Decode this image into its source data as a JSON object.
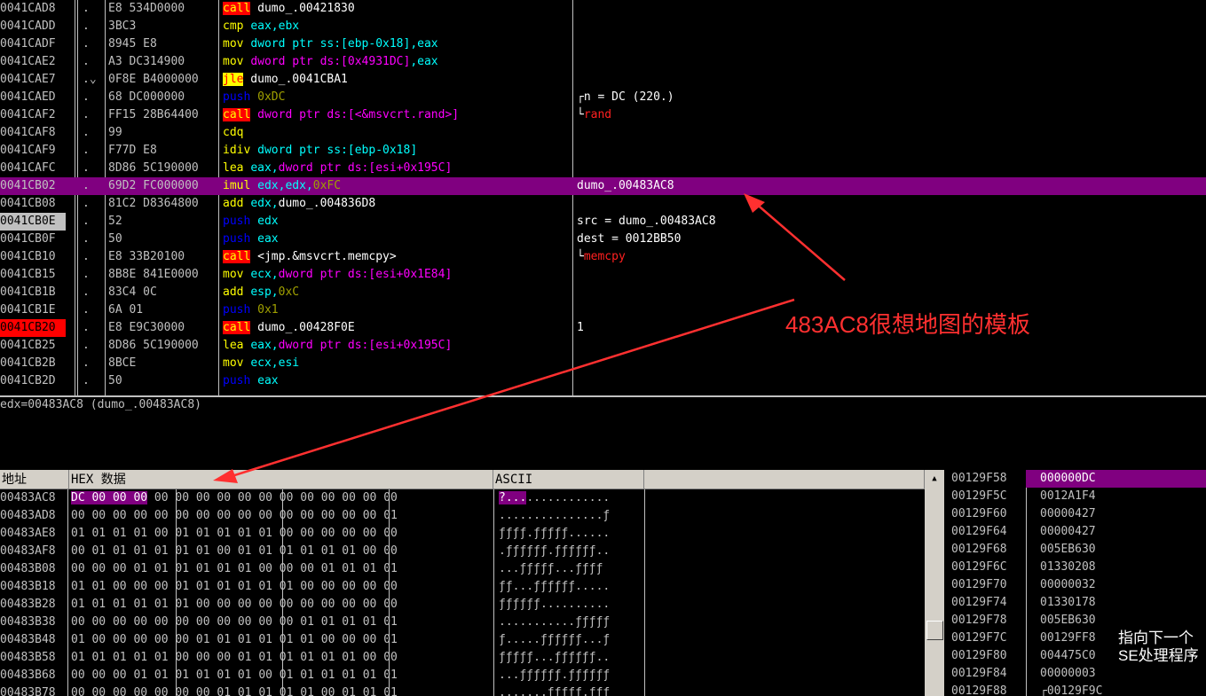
{
  "disasm": [
    {
      "addr": "0041CAD8",
      "mark": ".",
      "hex": "E8 534D0000",
      "asm": [
        [
          "callbg",
          "call"
        ],
        [
          "white",
          " dumo_.00421830"
        ]
      ],
      "cmt": []
    },
    {
      "addr": "0041CADD",
      "mark": ".",
      "hex": "3BC3",
      "asm": [
        [
          "yellow",
          "cmp "
        ],
        [
          "cyan",
          "eax,ebx"
        ]
      ],
      "cmt": []
    },
    {
      "addr": "0041CADF",
      "mark": ".",
      "hex": "8945 E8",
      "asm": [
        [
          "yellow",
          "mov "
        ],
        [
          "cyan",
          "dword ptr ss:[ebp-0x18],eax"
        ]
      ],
      "cmt": []
    },
    {
      "addr": "0041CAE2",
      "mark": ".",
      "hex": "A3 DC314900",
      "asm": [
        [
          "yellow",
          "mov "
        ],
        [
          "mag",
          "dword ptr ds:[0x4931DC]"
        ],
        [
          "cyan",
          ",eax"
        ]
      ],
      "cmt": []
    },
    {
      "addr": "0041CAE7",
      "mark": ".⌄",
      "hex": "0F8E B4000000",
      "asm": [
        [
          "jmpbg",
          "jle"
        ],
        [
          "white",
          " dumo_.0041CBA1"
        ]
      ],
      "cmt": []
    },
    {
      "addr": "0041CAED",
      "mark": ".",
      "hex": "68 DC000000",
      "asm": [
        [
          "blue",
          "push "
        ],
        [
          "oliv",
          "0xDC"
        ]
      ],
      "cmt": [
        [
          "white",
          "┌n = DC (220.)"
        ]
      ]
    },
    {
      "addr": "0041CAF2",
      "mark": ".",
      "hex": "FF15 28B64400",
      "asm": [
        [
          "callbg",
          "call"
        ],
        [
          "mag",
          " dword ptr ds:[<&msvcrt.rand>]"
        ]
      ],
      "cmt": [
        [
          "white",
          "└"
        ],
        [
          "red",
          "rand"
        ]
      ]
    },
    {
      "addr": "0041CAF8",
      "mark": ".",
      "hex": "99",
      "asm": [
        [
          "yellow",
          "cdq"
        ]
      ],
      "cmt": []
    },
    {
      "addr": "0041CAF9",
      "mark": ".",
      "hex": "F77D E8",
      "asm": [
        [
          "yellow",
          "idiv "
        ],
        [
          "cyan",
          "dword ptr ss:[ebp-0x18]"
        ]
      ],
      "cmt": []
    },
    {
      "addr": "0041CAFC",
      "mark": ".",
      "hex": "8D86 5C190000",
      "asm": [
        [
          "yellow",
          "lea "
        ],
        [
          "cyan",
          "eax,"
        ],
        [
          "mag",
          "dword ptr ds:[esi+0x195C]"
        ]
      ],
      "cmt": []
    },
    {
      "addr": "0041CB02",
      "mark": ".",
      "hex": "69D2 FC000000",
      "asm": [
        [
          "yellow",
          "imul "
        ],
        [
          "cyan",
          "edx,edx,"
        ],
        [
          "oliv",
          "0xFC"
        ]
      ],
      "cmt": [
        [
          "white",
          "dumo_.00483AC8"
        ]
      ],
      "selected": true
    },
    {
      "addr": "0041CB08",
      "mark": ".",
      "hex": "81C2 D8364800",
      "asm": [
        [
          "yellow",
          "add "
        ],
        [
          "cyan",
          "edx,"
        ],
        [
          "white",
          "dumo_.004836D8"
        ]
      ],
      "cmt": []
    },
    {
      "addr": "0041CB0E",
      "mark": ".",
      "hex": "52",
      "asm": [
        [
          "blue",
          "push "
        ],
        [
          "cyan",
          "edx"
        ]
      ],
      "cmt": [
        [
          "white",
          "src = dumo_.00483AC8"
        ]
      ],
      "addrhl": "hl1"
    },
    {
      "addr": "0041CB0F",
      "mark": ".",
      "hex": "50",
      "asm": [
        [
          "blue",
          "push "
        ],
        [
          "cyan",
          "eax"
        ]
      ],
      "cmt": [
        [
          "white",
          "dest = 0012BB50"
        ]
      ]
    },
    {
      "addr": "0041CB10",
      "mark": ".",
      "hex": "E8 33B20100",
      "asm": [
        [
          "callbg",
          "call"
        ],
        [
          "white",
          " <jmp.&msvcrt.memcpy>"
        ]
      ],
      "cmt": [
        [
          "white",
          "└"
        ],
        [
          "red",
          "memcpy"
        ]
      ]
    },
    {
      "addr": "0041CB15",
      "mark": ".",
      "hex": "8B8E 841E0000",
      "asm": [
        [
          "yellow",
          "mov "
        ],
        [
          "cyan",
          "ecx,"
        ],
        [
          "mag",
          "dword ptr ds:[esi+0x1E84]"
        ]
      ],
      "cmt": []
    },
    {
      "addr": "0041CB1B",
      "mark": ".",
      "hex": "83C4 0C",
      "asm": [
        [
          "yellow",
          "add "
        ],
        [
          "cyan",
          "esp,"
        ],
        [
          "oliv",
          "0xC"
        ]
      ],
      "cmt": []
    },
    {
      "addr": "0041CB1E",
      "mark": ".",
      "hex": "6A 01",
      "asm": [
        [
          "blue",
          "push "
        ],
        [
          "oliv",
          "0x1"
        ]
      ],
      "cmt": []
    },
    {
      "addr": "0041CB20",
      "mark": ".",
      "hex": "E8 E9C30000",
      "asm": [
        [
          "callbg",
          "call"
        ],
        [
          "white",
          " dumo_.00428F0E"
        ]
      ],
      "cmt": [
        [
          "white",
          "1"
        ]
      ],
      "addrhl": "hl2"
    },
    {
      "addr": "0041CB25",
      "mark": ".",
      "hex": "8D86 5C190000",
      "asm": [
        [
          "yellow",
          "lea "
        ],
        [
          "cyan",
          "eax,"
        ],
        [
          "mag",
          "dword ptr ds:[esi+0x195C]"
        ]
      ],
      "cmt": []
    },
    {
      "addr": "0041CB2B",
      "mark": ".",
      "hex": "8BCE",
      "asm": [
        [
          "yellow",
          "mov "
        ],
        [
          "cyan",
          "ecx,esi"
        ]
      ],
      "cmt": []
    },
    {
      "addr": "0041CB2D",
      "mark": ".",
      "hex": "50",
      "asm": [
        [
          "blue",
          "push "
        ],
        [
          "cyan",
          "eax"
        ]
      ],
      "cmt": []
    }
  ],
  "info_line": "edx=00483AC8 (dumo_.00483AC8)",
  "dump": {
    "headers": {
      "address": "地址",
      "hex": "HEX 数据",
      "ascii": "ASCII"
    },
    "rows": [
      {
        "addr": "00483AC8",
        "hex": [
          "DC 00 00 00",
          "00 00 00 00",
          "00 00 00 00",
          "00 00 00 00"
        ],
        "ascii": "?..............."
      },
      {
        "addr": "00483AD8",
        "hex": [
          "00 00 00 00",
          "00 00 00 00",
          "00 00 00 00",
          "00 00 00 01"
        ],
        "ascii": "...............ƒ"
      },
      {
        "addr": "00483AE8",
        "hex": [
          "01 01 01 01",
          "00 01 01 01",
          "01 01 00 00",
          "00 00 00 00"
        ],
        "ascii": "ƒƒƒƒ.ƒƒƒƒƒ......"
      },
      {
        "addr": "00483AF8",
        "hex": [
          "00 01 01 01",
          "01 01 01 00",
          "01 01 01 01",
          "01 01 00 00"
        ],
        "ascii": ".ƒƒƒƒƒƒ.ƒƒƒƒƒƒ.."
      },
      {
        "addr": "00483B08",
        "hex": [
          "00 00 00 01",
          "01 01 01 01",
          "01 00 00 00",
          "01 01 01 01"
        ],
        "ascii": "...ƒƒƒƒƒ...ƒƒƒƒ"
      },
      {
        "addr": "00483B18",
        "hex": [
          "01 01 00 00",
          "00 01 01 01",
          "01 01 01 00",
          "00 00 00 00"
        ],
        "ascii": "ƒƒ...ƒƒƒƒƒƒ....."
      },
      {
        "addr": "00483B28",
        "hex": [
          "01 01 01 01",
          "01 01 00 00",
          "00 00 00 00",
          "00 00 00 00"
        ],
        "ascii": "ƒƒƒƒƒƒ.........."
      },
      {
        "addr": "00483B38",
        "hex": [
          "00 00 00 00",
          "00 00 00 00",
          "00 00 00 01",
          "01 01 01 01"
        ],
        "ascii": "...........ƒƒƒƒƒ"
      },
      {
        "addr": "00483B48",
        "hex": [
          "01 00 00 00",
          "00 00 01 01",
          "01 01 01 01",
          "00 00 00 01"
        ],
        "ascii": "ƒ.....ƒƒƒƒƒƒ...ƒ"
      },
      {
        "addr": "00483B58",
        "hex": [
          "01 01 01 01",
          "01 00 00 00",
          "01 01 01 01",
          "01 01 00 00"
        ],
        "ascii": "ƒƒƒƒƒ...ƒƒƒƒƒƒ.."
      },
      {
        "addr": "00483B68",
        "hex": [
          "00 00 00 01",
          "01 01 01 01",
          "01 00 01 01",
          "01 01 01 01"
        ],
        "ascii": "...ƒƒƒƒƒƒ.ƒƒƒƒƒƒ"
      },
      {
        "addr": "00483B78",
        "hex": [
          "00 00 00 00",
          "00 00 00 01",
          "01 01 01 01",
          "00 01 01 01"
        ],
        "ascii": ".......ƒƒƒƒƒ.ƒƒƒ"
      }
    ]
  },
  "stack": [
    {
      "addr": "00129F58",
      "val": "000000DC",
      "cmt": "",
      "selected": true
    },
    {
      "addr": "00129F5C",
      "val": "0012A1F4",
      "cmt": ""
    },
    {
      "addr": "00129F60",
      "val": "00000427",
      "cmt": ""
    },
    {
      "addr": "00129F64",
      "val": "00000427",
      "cmt": ""
    },
    {
      "addr": "00129F68",
      "val": "005EB630",
      "cmt": ""
    },
    {
      "addr": "00129F6C",
      "val": "01330208",
      "cmt": ""
    },
    {
      "addr": "00129F70",
      "val": "00000032",
      "cmt": ""
    },
    {
      "addr": "00129F74",
      "val": "01330178",
      "cmt": ""
    },
    {
      "addr": "00129F78",
      "val": "005EB630",
      "cmt": ""
    },
    {
      "addr": "00129F7C",
      "val": "00129FF8",
      "cmt": "指向下一个"
    },
    {
      "addr": "00129F80",
      "val": "004475C0",
      "cmt": "SE处理程序"
    },
    {
      "addr": "00129F84",
      "val": "00000003",
      "cmt": ""
    },
    {
      "addr": "00129F88",
      "val": "┌00129F9C",
      "cmt": ""
    }
  ],
  "annotation": "483AC8很想地图的模板",
  "colors": {
    "selection": "#800080",
    "annotation": "#ff3030",
    "call_bg": "#ff0000",
    "call_fg": "#ffff00"
  },
  "icons": {
    "scroll_up": "triangle-up-icon"
  }
}
